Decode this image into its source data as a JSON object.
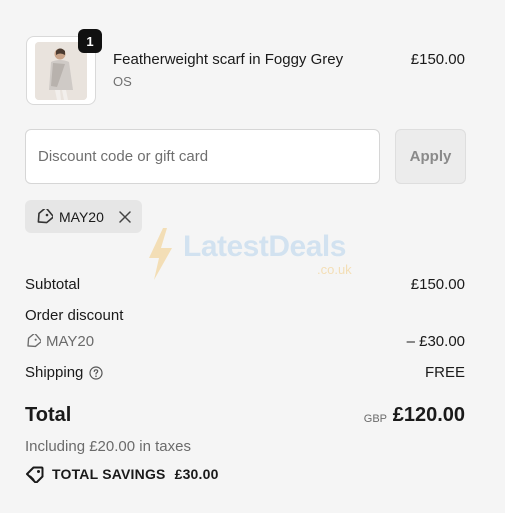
{
  "product": {
    "quantity": "1",
    "name": "Featherweight scarf in Foggy Grey",
    "variant": "OS",
    "price": "£150.00"
  },
  "discount": {
    "placeholder": "Discount code or gift card",
    "apply_label": "Apply",
    "applied_code": "MAY20"
  },
  "watermark": {
    "brand": "LatestDeals",
    "suffix": ".co.uk"
  },
  "summary": {
    "subtotal_label": "Subtotal",
    "subtotal_value": "£150.00",
    "order_discount_label": "Order discount",
    "discount_code": "MAY20",
    "discount_value": "– £30.00",
    "shipping_label": "Shipping",
    "shipping_value": "FREE",
    "total_label": "Total",
    "currency": "GBP",
    "total_value": "£120.00",
    "tax_note": "Including £20.00 in taxes",
    "savings_label": "TOTAL SAVINGS",
    "savings_value": "£30.00"
  },
  "colors": {
    "background": "#f5f5f5",
    "badge": "#111111",
    "apply_disabled": "#ececec"
  }
}
